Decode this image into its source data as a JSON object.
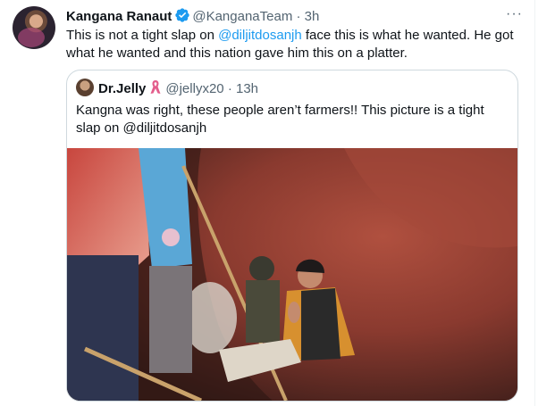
{
  "tweet": {
    "author_name": "Kangana Ranaut",
    "author_handle": "@KanganaTeam",
    "separator": "·",
    "time": "3h",
    "more_label": "···",
    "text_part1": "This is not a tight slap on ",
    "mention": "@diljitdosanjh",
    "text_part2": " face this is what he wanted. He got what he wanted and this nation gave him this on a platter."
  },
  "quoted": {
    "author_name": "Dr.Jelly",
    "author_handle": "@jellyx20",
    "separator": "·",
    "time": "13h",
    "text_part1": "Kangna was right, these people aren’t farmers!! This picture is a tight slap on ",
    "mention": "@diljitdosanjh"
  },
  "colors": {
    "accent": "#1d9bf0",
    "text": "#0f1419",
    "muted": "#536471",
    "border": "#cfd9de"
  }
}
